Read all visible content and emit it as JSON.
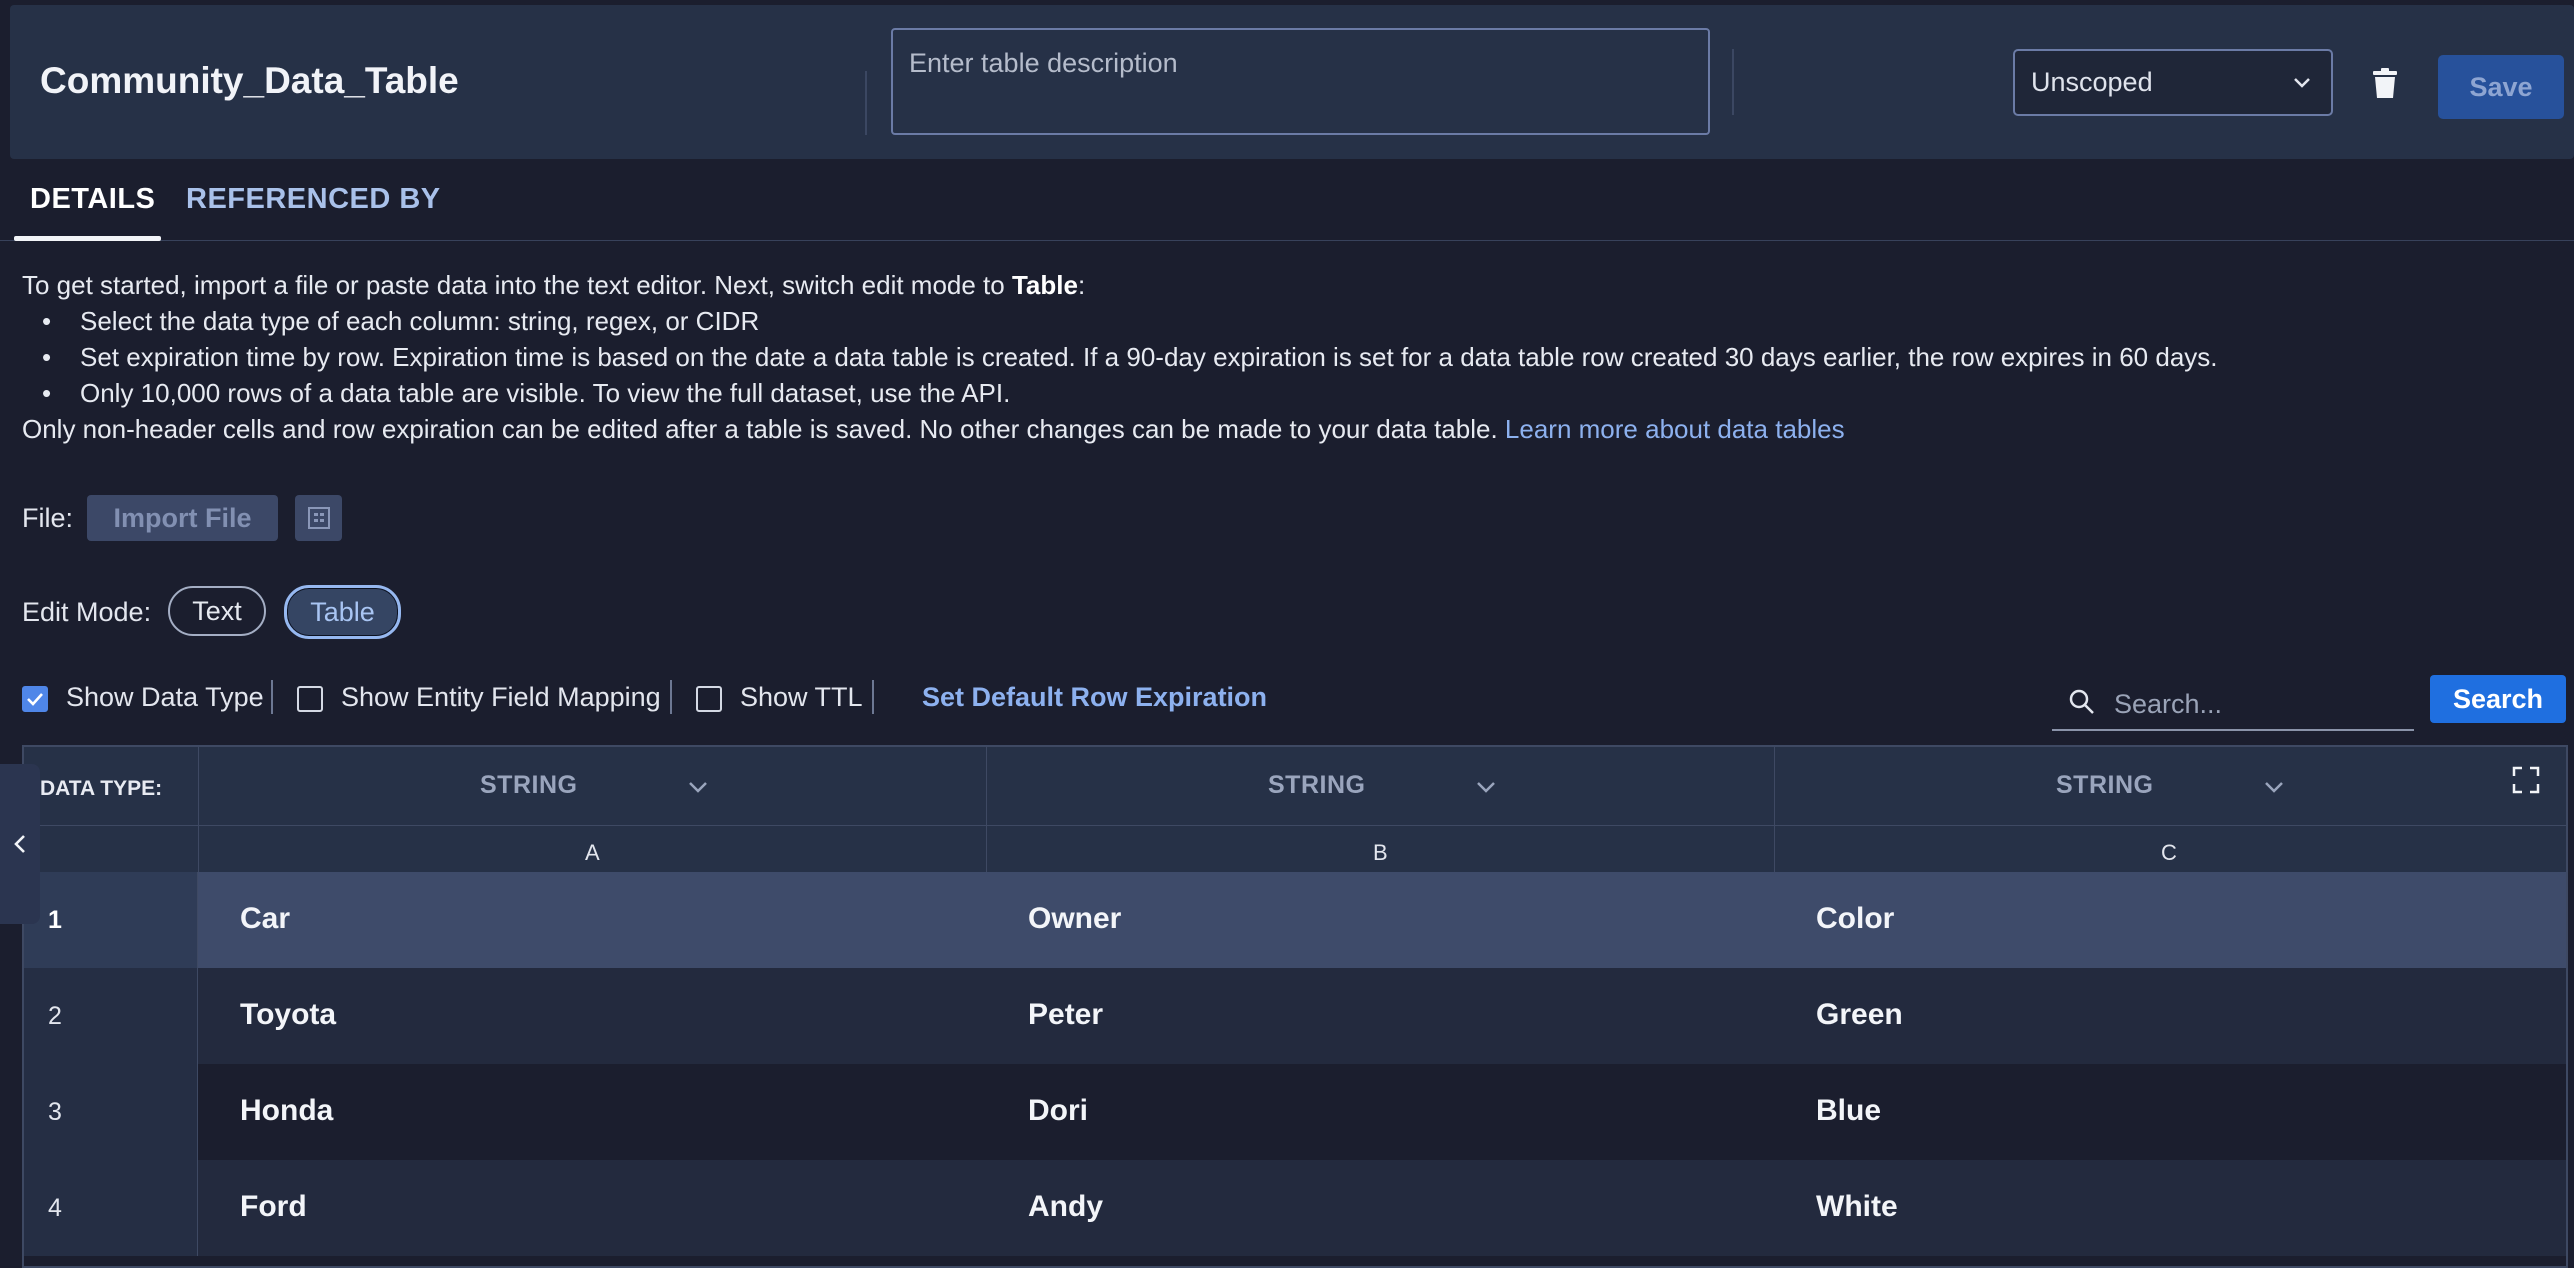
{
  "header": {
    "title": "Community_Data_Table",
    "description_placeholder": "Enter table description",
    "scope_value": "Unscoped",
    "save_label": "Save"
  },
  "tabs": [
    {
      "label": "DETAILS",
      "active": true
    },
    {
      "label": "REFERENCED BY",
      "active": false
    }
  ],
  "info": {
    "intro": "To get started, import a file or paste data into the text editor. Next, switch edit mode to ",
    "intro_bold": "Table",
    "intro_end": ":",
    "bullets": [
      "Select the data type of each column: string, regex, or CIDR",
      "Set expiration time by row. Expiration time is based on the date a data table is created. If a 90-day expiration is set for a data table row created 30 days earlier, the row expires in 60 days.",
      "Only 10,000 rows of a data table are visible. To view the full dataset, use the API."
    ],
    "footer": "Only non-header cells and row expiration can be edited after a table is saved. No other changes can be made to your data table. ",
    "link": "Learn more about data tables"
  },
  "file": {
    "label": "File:",
    "import_label": "Import File"
  },
  "edit_mode": {
    "label": "Edit Mode:",
    "options": [
      "Text",
      "Table"
    ],
    "selected": "Table"
  },
  "toolbar": {
    "show_data_type": {
      "label": "Show Data Type",
      "checked": true
    },
    "show_entity_field_mapping": {
      "label": "Show Entity Field Mapping",
      "checked": false
    },
    "show_ttl": {
      "label": "Show TTL",
      "checked": false
    },
    "default_expiration_label": "Set Default Row Expiration",
    "search_placeholder": "Search...",
    "search_button": "Search"
  },
  "table": {
    "data_type_label": "DATA TYPE:",
    "column_types": [
      "STRING",
      "STRING",
      "STRING"
    ],
    "columns": [
      "A",
      "B",
      "C"
    ],
    "rows": [
      {
        "num": "1",
        "cells": [
          "Car",
          "Owner",
          "Color"
        ]
      },
      {
        "num": "2",
        "cells": [
          "Toyota",
          "Peter",
          "Green"
        ]
      },
      {
        "num": "3",
        "cells": [
          "Honda",
          "Dori",
          "Blue"
        ]
      },
      {
        "num": "4",
        "cells": [
          "Ford",
          "Andy",
          "White"
        ]
      }
    ]
  },
  "icons": {
    "trash": "trash-icon",
    "grid": "table-grid-icon",
    "search": "search-icon",
    "expand": "expand-icon",
    "collapse": "chevron-left-icon"
  },
  "colors": {
    "accent": "#1f6fe0",
    "link": "#8db1ef",
    "header_bg": "#263147",
    "page_bg": "#1b1e2e"
  }
}
